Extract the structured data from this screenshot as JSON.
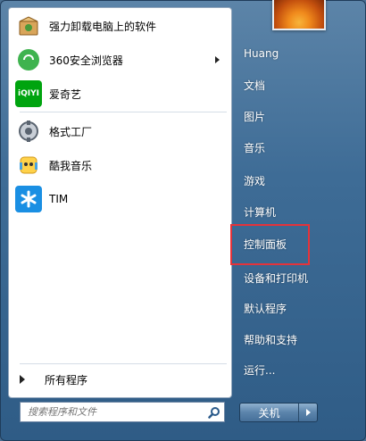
{
  "programs": [
    {
      "label": "强力卸载电脑上的软件",
      "icon": "uninstall-box-icon"
    },
    {
      "label": "360安全浏览器",
      "icon": "360-browser-icon",
      "has_submenu": true
    },
    {
      "label": "爱奇艺",
      "icon": "iqiyi-icon",
      "icon_text": "iQIYI"
    },
    {
      "label": "格式工厂",
      "icon": "format-factory-icon"
    },
    {
      "label": "酷我音乐",
      "icon": "kuwo-music-icon"
    },
    {
      "label": "TIM",
      "icon": "tim-icon"
    }
  ],
  "all_programs": "所有程序",
  "search": {
    "placeholder": "搜索程序和文件"
  },
  "user": {
    "name": "Huang"
  },
  "right_items": [
    "Huang",
    "文档",
    "图片",
    "音乐",
    "游戏",
    "计算机",
    "控制面板",
    "设备和打印机",
    "默认程序",
    "帮助和支持",
    "运行..."
  ],
  "highlighted_item": "控制面板",
  "shutdown": {
    "label": "关机"
  },
  "colors": {
    "highlight": "#e5333a",
    "frame": "#3e6c96"
  }
}
